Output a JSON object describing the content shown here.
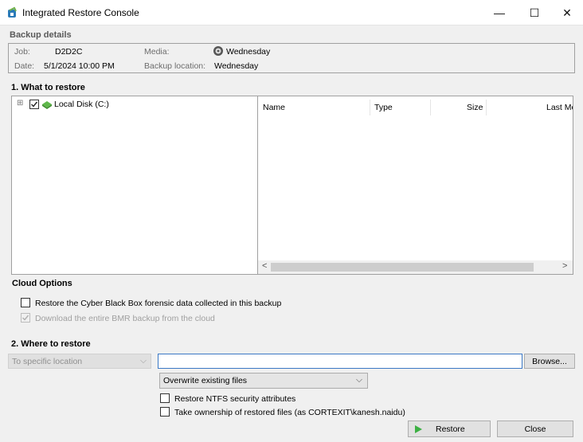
{
  "window": {
    "title": "Integrated Restore Console",
    "minimize_glyph": "—",
    "maximize_glyph": "☐",
    "close_glyph": "✕"
  },
  "backup_details": {
    "section_title": "Backup details",
    "job_label": "Job:",
    "job_value": "D2D2C",
    "date_label": "Date:",
    "date_value": "5/1/2024 10:00 PM",
    "media_label": "Media:",
    "media_value": "Wednesday",
    "location_label": "Backup location:",
    "location_value": "Wednesday"
  },
  "what_to_restore": {
    "section_title": "1. What to restore",
    "tree": {
      "expander": "⊞",
      "checked": true,
      "drive_label": "Local Disk (C:)"
    },
    "columns": [
      "Name",
      "Type",
      "Size",
      "Last Mo"
    ],
    "scroll_left": "<",
    "scroll_right": ">"
  },
  "cloud_options": {
    "section_title": "Cloud Options",
    "restore_cyber_black_box": {
      "label": "Restore the Cyber Black Box forensic data collected in this backup",
      "checked": false,
      "enabled": true
    },
    "download_bmr": {
      "label": "Download the entire BMR backup from the cloud",
      "checked": true,
      "enabled": false
    }
  },
  "where_to_restore": {
    "section_title": "2. Where to restore",
    "location_mode": "To specific location",
    "path_value": "",
    "browse_label": "Browse...",
    "overwrite_mode": "Overwrite existing files",
    "restore_ntfs": {
      "label": "Restore NTFS security attributes",
      "checked": false
    },
    "take_ownership": {
      "label": "Take ownership of restored files (as CORTEXIT\\kanesh.naidu)",
      "checked": false
    }
  },
  "actions": {
    "restore_label": "Restore",
    "close_label": "Close"
  },
  "colors": {
    "accent": "#3b78c5",
    "restore_icon": "#3cb043"
  }
}
